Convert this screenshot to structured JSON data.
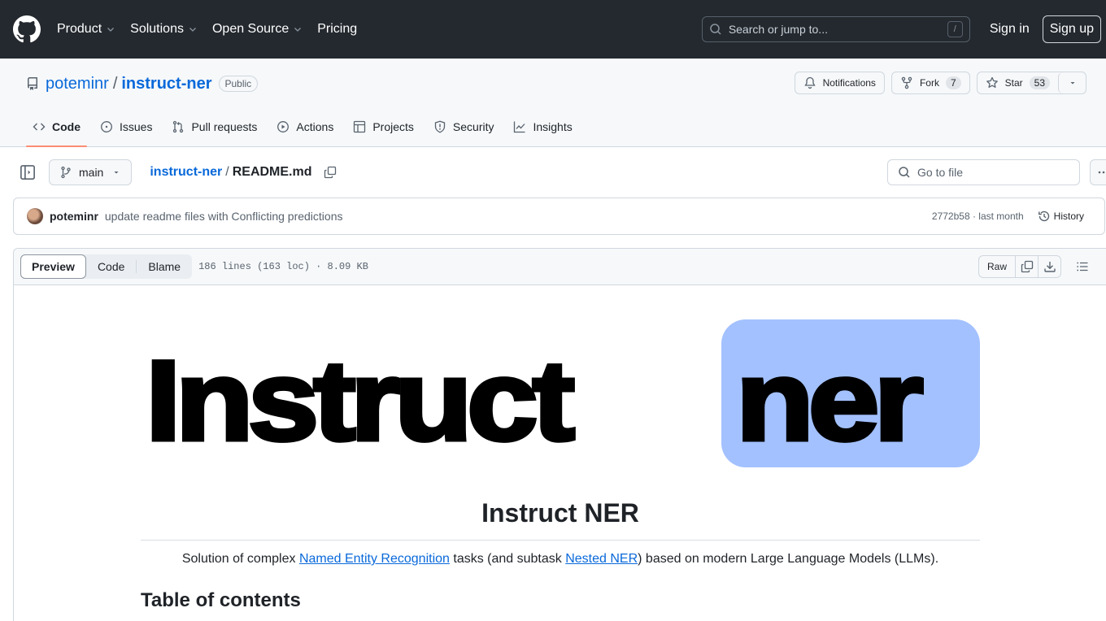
{
  "topbar": {
    "nav": [
      {
        "label": "Product",
        "has_menu": true
      },
      {
        "label": "Solutions",
        "has_menu": true
      },
      {
        "label": "Open Source",
        "has_menu": true
      },
      {
        "label": "Pricing",
        "has_menu": false
      }
    ],
    "search_placeholder": "Search or jump to...",
    "search_shortcut": "/",
    "sign_in": "Sign in",
    "sign_up": "Sign up"
  },
  "repo": {
    "owner": "poteminr",
    "separator": "/",
    "name": "instruct-ner",
    "visibility": "Public",
    "notifications_label": "Notifications",
    "fork_label": "Fork",
    "fork_count": "7",
    "star_label": "Star",
    "star_count": "53",
    "tabs": [
      {
        "label": "Code",
        "icon": "code-icon",
        "active": true
      },
      {
        "label": "Issues",
        "icon": "issue-icon"
      },
      {
        "label": "Pull requests",
        "icon": "pull-request-icon"
      },
      {
        "label": "Actions",
        "icon": "play-icon"
      },
      {
        "label": "Projects",
        "icon": "table-icon"
      },
      {
        "label": "Security",
        "icon": "shield-icon"
      },
      {
        "label": "Insights",
        "icon": "graph-icon"
      }
    ]
  },
  "filebar": {
    "branch": "main",
    "crumb_repo": "instruct-ner",
    "crumb_sep": "/",
    "crumb_file": "README.md",
    "goto_placeholder": "Go to file"
  },
  "commit": {
    "author": "poteminr",
    "message": "update readme files with Conflicting predictions",
    "meta": "2772b58 · last month",
    "history_label": "History"
  },
  "viewer": {
    "tabs": [
      "Preview",
      "Code",
      "Blame"
    ],
    "active_tab": "Preview",
    "file_info": "186 lines (163 loc) · 8.09 KB",
    "raw_label": "Raw"
  },
  "readme": {
    "banner_left": "Instruct",
    "banner_right": "ner",
    "banner_box_color": "#a3c1ff",
    "title": "Instruct NER",
    "intro": {
      "before": "Solution of complex ",
      "link1": "Named Entity Recognition",
      "middle": " tasks (and subtask ",
      "link2": "Nested NER",
      "after": ") based on modern Large Language Models (LLMs)."
    },
    "toc_heading": "Table of contents"
  }
}
